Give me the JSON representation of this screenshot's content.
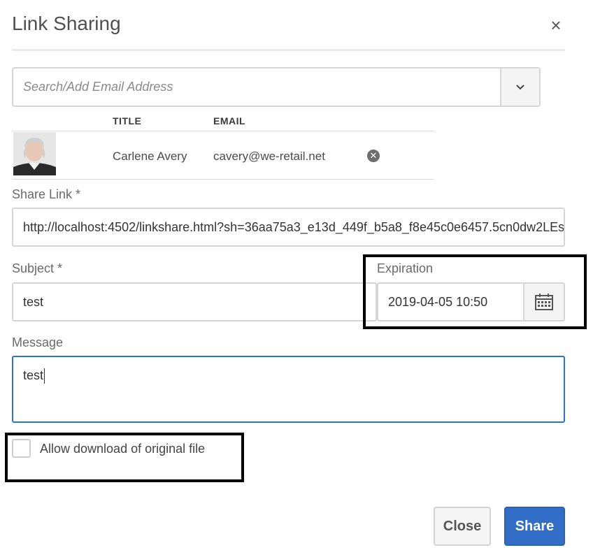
{
  "dialog": {
    "title": "Link Sharing",
    "close_glyph": "×"
  },
  "search": {
    "placeholder": "Search/Add Email Address",
    "toggle_icon": "chevron-down-icon"
  },
  "users_table": {
    "headers": [
      "TITLE",
      "EMAIL"
    ],
    "rows": [
      {
        "title": "Carlene Avery",
        "email": "cavery@we-retail.net",
        "remove_icon": "remove-circle-icon"
      }
    ]
  },
  "share_link": {
    "label": "Share Link *",
    "value": "http://localhost:4502/linkshare.html?sh=36aa75a3_e13d_449f_b5a8_f8e45c0e6457.5cn0dw2LEs"
  },
  "subject": {
    "label": "Subject *",
    "value": "test"
  },
  "expiration": {
    "label": "Expiration",
    "value": "2019-04-05 10:50",
    "button_icon": "calendar-icon"
  },
  "message": {
    "label": "Message",
    "value": "test"
  },
  "allow_download": {
    "label": "Allow download of original file",
    "checked": false
  },
  "buttons": {
    "close": "Close",
    "share": "Share"
  },
  "colors": {
    "primary": "#326ec8",
    "focus_border": "#2b73ce",
    "highlight_box": "#000000"
  }
}
